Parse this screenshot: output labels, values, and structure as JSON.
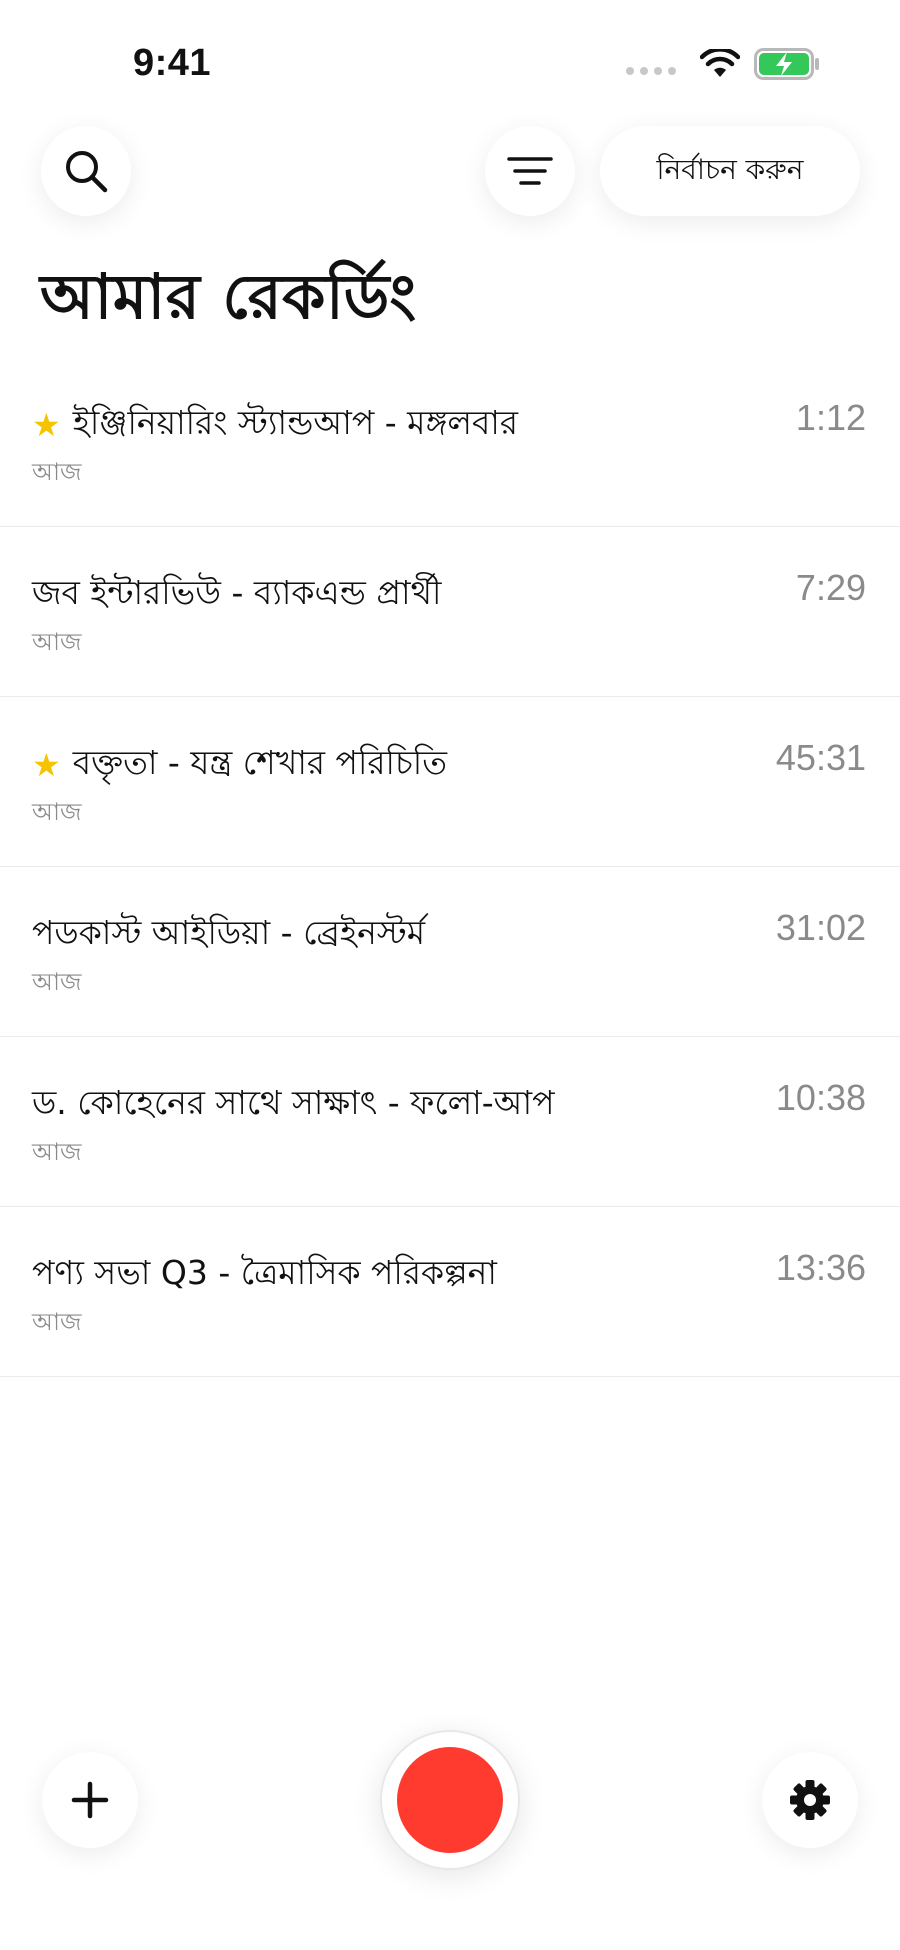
{
  "status_bar": {
    "time": "9:41",
    "battery_color": "#34c759"
  },
  "toolbar": {
    "select_label": "নির্বাচন করুন"
  },
  "page_title": "আমার রেকর্ডিং",
  "recordings": [
    {
      "title": "ইঞ্জিনিয়ারিং স্ট্যান্ডআপ - মঙ্গলবার",
      "subtitle": "আজ",
      "duration": "1:12",
      "starred": true
    },
    {
      "title": "জব ইন্টারভিউ - ব্যাকএন্ড প্রার্থী",
      "subtitle": "আজ",
      "duration": "7:29",
      "starred": false
    },
    {
      "title": "বক্তৃতা - যন্ত্র শেখার পরিচিতি",
      "subtitle": "আজ",
      "duration": "45:31",
      "starred": true
    },
    {
      "title": "পডকাস্ট আইডিয়া - ব্রেইনস্টর্ম",
      "subtitle": "আজ",
      "duration": "31:02",
      "starred": false
    },
    {
      "title": "ড. কোহেনের সাথে সাক্ষাৎ - ফলো-আপ",
      "subtitle": "আজ",
      "duration": "10:38",
      "starred": false
    },
    {
      "title": "পণ্য সভা Q3 - ত্রৈমাসিক পরিকল্পনা",
      "subtitle": "আজ",
      "duration": "13:36",
      "starred": false
    }
  ],
  "icons": {
    "search": "search-icon",
    "filter": "filter-icon",
    "add": "plus-icon",
    "record": "record-icon",
    "settings": "gear-icon",
    "star": "star-icon"
  },
  "colors": {
    "record": "#ff3b30",
    "star": "#f5c400",
    "secondary_text": "#8a8a8a"
  }
}
